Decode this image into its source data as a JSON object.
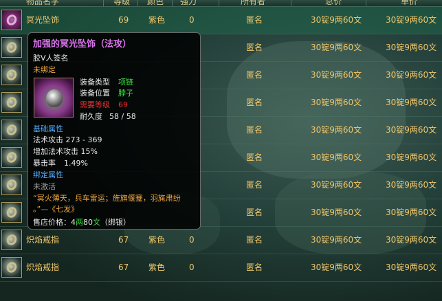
{
  "header": {
    "cols": [
      "物品名字",
      "等级",
      "颜色",
      "强力",
      "所有者",
      "总价",
      "单价"
    ]
  },
  "rows": [
    {
      "name": "冥光坠饰",
      "level": "69",
      "color": "紫色",
      "strength": "0",
      "owner": "匿名",
      "total": "30锭9两60文",
      "unit": "30锭9两60文",
      "icon": "pendant-icon",
      "selected": true
    },
    {
      "name": "",
      "level": "",
      "color": "",
      "strength": "",
      "owner": "匿名",
      "total": "30锭9两60文",
      "unit": "30锭9两60文",
      "icon": "ring-icon"
    },
    {
      "name": "",
      "level": "",
      "color": "",
      "strength": "",
      "owner": "匿名",
      "total": "30锭9两60文",
      "unit": "30锭9两60文",
      "icon": "ring-icon"
    },
    {
      "name": "",
      "level": "",
      "color": "",
      "strength": "",
      "owner": "匿名",
      "total": "30锭9两60文",
      "unit": "30锭9两60文",
      "icon": "ring-icon"
    },
    {
      "name": "",
      "level": "",
      "color": "",
      "strength": "",
      "owner": "匿名",
      "total": "30锭9两60文",
      "unit": "30锭9两60文",
      "icon": "ring-icon"
    },
    {
      "name": "",
      "level": "",
      "color": "",
      "strength": "",
      "owner": "匿名",
      "total": "30锭9两60文",
      "unit": "30锭9两60文",
      "icon": "ring-icon"
    },
    {
      "name": "",
      "level": "",
      "color": "",
      "strength": "",
      "owner": "匿名",
      "total": "30锭9两60文",
      "unit": "30锭9两60文",
      "icon": "ring-icon"
    },
    {
      "name": "",
      "level": "",
      "color": "",
      "strength": "",
      "owner": "匿名",
      "total": "30锭9两60文",
      "unit": "30锭9两60文",
      "icon": "ring-icon"
    },
    {
      "name": "炽焰戒指",
      "level": "67",
      "color": "紫色",
      "strength": "0",
      "owner": "匿名",
      "total": "30锭9两60文",
      "unit": "30锭9两60文",
      "icon": "ring-icon"
    },
    {
      "name": "炽焰戒指",
      "level": "67",
      "color": "紫色",
      "strength": "0",
      "owner": "匿名",
      "total": "30锭9两60文",
      "unit": "30锭9两60文",
      "icon": "ring-icon"
    }
  ],
  "tooltip": {
    "title": "加强的冥光坠饰（法攻）",
    "signature": "胶V人签名",
    "bind_state": "未绑定",
    "type_label": "装备类型",
    "type_value": "项链",
    "slot_label": "装备位置",
    "slot_value": "脖子",
    "req_label": "需要等级",
    "req_value": "69",
    "durability_label": "耐久度",
    "durability_value": "58 / 58",
    "base_header": "基础属性",
    "attr1": "法术攻击 273 - 369",
    "attr2": "增加法术攻击 15%",
    "attr3_label": "暴击率",
    "attr3_value": "1.49%",
    "bind_header": "绑定属性",
    "inactive": "未激活",
    "poem1": "“冥火薄天，兵车雷运；旌旗偃蹇，羽旄肃纷",
    "poem2": "。”—《七发》",
    "price_label": "售店价格：",
    "price_num1": "4",
    "price_unit1": "两",
    "price_num2": "80",
    "price_unit2": "文",
    "price_note": "（绑银）"
  },
  "colors": {
    "gold": "#f1c76c",
    "title_purple": "#dc74ee",
    "green": "#3ce040",
    "red": "#e53030",
    "blue": "#4ea7f8",
    "orange": "#f0a640"
  }
}
